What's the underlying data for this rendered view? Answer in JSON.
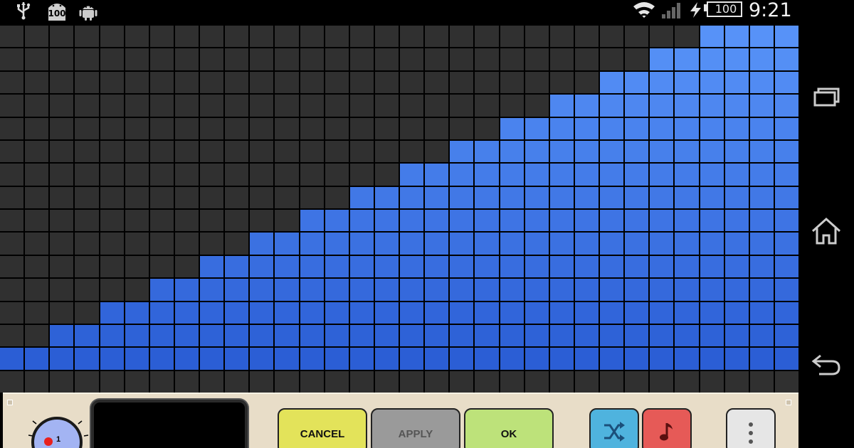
{
  "status_bar": {
    "icons_left": [
      "usb-icon",
      "notification-badge-icon",
      "android-icon"
    ],
    "notification_badge": "100",
    "icons_right": [
      "wifi-icon",
      "signal-icon",
      "charging-icon",
      "battery-icon"
    ],
    "battery_level": "100",
    "time": "9:21"
  },
  "grid": {
    "columns": 32,
    "rows": 16,
    "column_levels": [
      1,
      1,
      2,
      2,
      3,
      3,
      4,
      4,
      5,
      5,
      6,
      6,
      7,
      7,
      8,
      8,
      9,
      9,
      10,
      10,
      11,
      11,
      12,
      12,
      13,
      13,
      14,
      14,
      15,
      15,
      16,
      16
    ],
    "active_color": "#3a6fe6",
    "inactive_color": "#303030"
  },
  "panel": {
    "knob_value": "1",
    "buttons": {
      "cancel": "CANCEL",
      "apply": "APPLY",
      "ok": "OK"
    },
    "icon_buttons": [
      "shuffle-icon",
      "music-note-icon",
      "more-vert-icon"
    ],
    "colors": {
      "cancel": "#e3e35a",
      "apply": "#9a9a9a",
      "ok": "#bde27a",
      "shuffle": "#4fb3de",
      "music": "#e65a57",
      "more": "#e6e6e6"
    }
  },
  "nav_bar": {
    "buttons": [
      "recent-apps-icon",
      "home-icon",
      "back-icon"
    ]
  }
}
